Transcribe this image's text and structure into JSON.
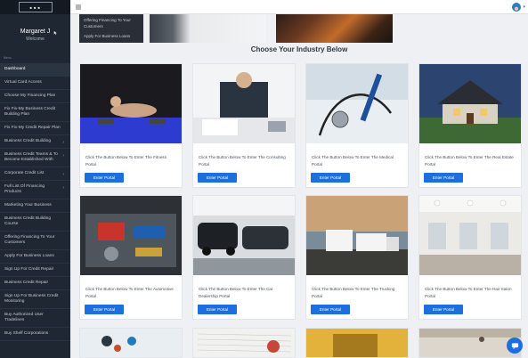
{
  "sidebar": {
    "logo_text": "■ ■ ■",
    "user_name": "Margaret J",
    "welcome": "Welcome",
    "menu_label": "Menu",
    "items": [
      {
        "label": "Dashboard",
        "active": true,
        "chevron": false
      },
      {
        "label": "Virtual Card Access",
        "chevron": false
      },
      {
        "label": "Choose My Financing Plan",
        "chevron": false
      },
      {
        "label": "Fix Fix-My Business Credit Building Plan",
        "chevron": false
      },
      {
        "label": "Fix Fix-My Credit Repair Plan",
        "chevron": false
      },
      {
        "label": "Business Credit Building",
        "chevron": true
      },
      {
        "label": "Business Credit Teams & To Become Established With",
        "chevron": true
      },
      {
        "label": "Corporate Credit List",
        "chevron": true
      },
      {
        "label": "Full List Of Financing Products",
        "chevron": true
      },
      {
        "label": "Marketing Your Business",
        "chevron": false
      },
      {
        "label": "Business Credit Building Course",
        "chevron": false
      },
      {
        "label": "Offering Financing To Your Customers",
        "chevron": false
      },
      {
        "label": "Apply For Business Loans",
        "chevron": false
      },
      {
        "label": "Sign Up For Credit Repair",
        "chevron": false
      },
      {
        "label": "Business Credit Repair",
        "chevron": false
      },
      {
        "label": "Sign Up For Business Credit Monitoring",
        "chevron": false
      },
      {
        "label": "Buy Authorized User Tradelines",
        "chevron": false
      },
      {
        "label": "Buy Shelf Corporations",
        "chevron": false
      }
    ]
  },
  "banner": {
    "line1": "Offering Financing To Your Customers",
    "line2": "Apply For Business Loans"
  },
  "main": {
    "section_title": "Choose Your Industry Below",
    "cards": [
      {
        "caption": "Click The Button Below To Enter The Fitness Portal",
        "button": "Enter Portal",
        "photo": "fitness"
      },
      {
        "caption": "Click The Button Below To Enter The Consulting Portal",
        "button": "Enter Portal",
        "photo": "consulting"
      },
      {
        "caption": "Click The Button Below To Enter The Medical Portal",
        "button": "Enter Portal",
        "photo": "medical"
      },
      {
        "caption": "Click The Button Below To Enter The Real Estate Portal",
        "button": "Enter Portal",
        "photo": "real-estate"
      },
      {
        "caption": "Click The Button Below To Enter The Automotive Portal",
        "button": "Enter Portal",
        "photo": "automotive"
      },
      {
        "caption": "Click The Button Below To Enter The Car Dealership Portal",
        "button": "Enter Portal",
        "photo": "dealership"
      },
      {
        "caption": "Click The Button Below To Enter The Trucking Portal",
        "button": "Enter Portal",
        "photo": "trucking"
      },
      {
        "caption": "Click The Button Below To Enter The Hair Salon Portal",
        "button": "Enter Portal",
        "photo": "salon"
      }
    ]
  },
  "colors": {
    "sidebar_bg": "#1f2732",
    "accent": "#1d6fe0",
    "page_bg": "#eef0f3"
  }
}
